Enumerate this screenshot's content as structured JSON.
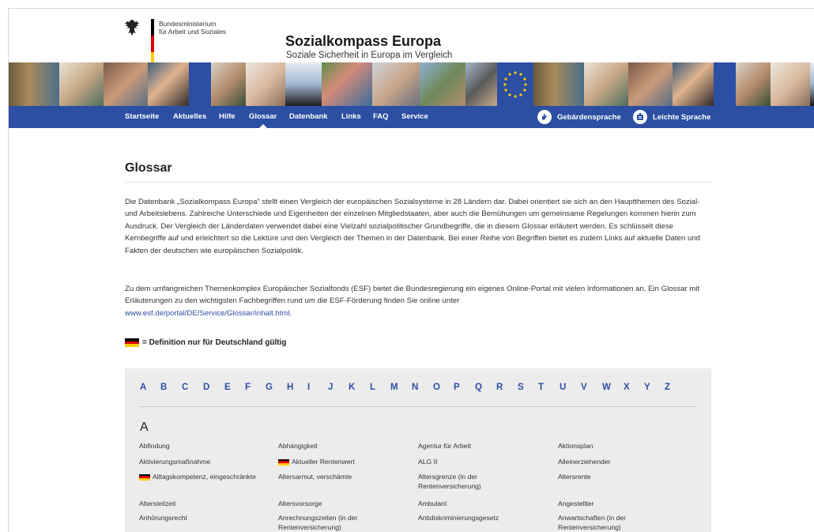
{
  "ministry": {
    "line1": "Bundesministerium",
    "line2": "für Arbeit und Soziales"
  },
  "site": {
    "title": "Sozialkompass Europa",
    "subtitle": "Soziale Sicherheit in Europa im Vergleich"
  },
  "nav": {
    "items": [
      "Startseite",
      "Aktuelles",
      "Hilfe",
      "Glossar",
      "Datenbank",
      "Links",
      "FAQ",
      "Service"
    ],
    "active": "Glossar",
    "right": [
      {
        "label": "Gebärdensprache",
        "icon": "sign-language-icon"
      },
      {
        "label": "Leichte Sprache",
        "icon": "easy-language-icon"
      }
    ]
  },
  "page": {
    "title": "Glossar",
    "paragraph1": "Die Datenbank „Sozialkompass Europa“ stellt einen Vergleich der europäischen Sozialsysteme in 28 Ländern dar. Dabei orientiert sie sich an den Hauptthemen des Sozial- und Arbeitslebens. Zahlreiche Unterschiede und Eigenheiten der einzelnen Mitgliedstaaten, aber auch die Bemühungen um gemeinsame Regelungen kommen hierin zum Ausdruck. Der Vergleich der Länderdaten verwendet dabei eine Vielzahl sozialpolitischer Grundbegriffe, die in diesem Glossar erläutert werden. Es schlüsselt diese Kernbegriffe auf und erleichtert so die Lektüre und den Vergleich der Themen in der Datenbank. Bei einer Reihe von Begriffen bietet es zudem Links auf aktuelle Daten und Fakten der deutschen wie europäischen Sozialpolitik.",
    "paragraph2": "Zu dem umfangreichen Themenkomplex Europäischer Sozialfonds (ESF) bietet die Bundesregierung ein eigenes Online-Portal mit vielen Informationen an. Ein Glossar mit Erläuterungen zu den wichtigsten Fachbegriffen rund um die ESF-Förderung finden Sie online unter",
    "link": "www.esf.de/portal/DE/Service/Glossar/inhalt.html.",
    "legend": "= Definition nur für Deutschland gültig"
  },
  "glossary": {
    "alphabet": [
      "A",
      "B",
      "C",
      "D",
      "E",
      "F",
      "G",
      "H",
      "I",
      "J",
      "K",
      "L",
      "M",
      "N",
      "O",
      "P",
      "Q",
      "R",
      "S",
      "T",
      "U",
      "V",
      "W",
      "X",
      "Y",
      "Z"
    ],
    "current_letter": "A",
    "columns": [
      [
        {
          "term": "Abfindung",
          "de": false
        },
        {
          "term": "Aktivierungsmaßnahme",
          "de": false
        },
        {
          "term": "Alltagskompetenz, eingeschränkte",
          "de": true
        },
        {
          "term": "Altersteilzeit",
          "de": false
        },
        {
          "term": "Anhörungsrecht",
          "de": false
        }
      ],
      [
        {
          "term": "Abhängigkeit",
          "de": false
        },
        {
          "term": "Aktueller Rentenwert",
          "de": true
        },
        {
          "term": "Altersarmut, verschämte",
          "de": false
        },
        {
          "term": "Altersvorsorge",
          "de": false
        },
        {
          "term": "Anrechnungszeiten (in der Rentenversicherung)",
          "de": false
        }
      ],
      [
        {
          "term": "Agentur für Arbeit",
          "de": false
        },
        {
          "term": "ALG II",
          "de": false
        },
        {
          "term": "Altersgrenze (in der Rentenversicherung)",
          "de": false
        },
        {
          "term": "Ambulant",
          "de": false
        },
        {
          "term": "Antidiskriminierungsgesetz",
          "de": false
        }
      ],
      [
        {
          "term": "Aktionsplan",
          "de": false
        },
        {
          "term": "Alleinerziehender",
          "de": false
        },
        {
          "term": "Altersrente",
          "de": false
        },
        {
          "term": "Angestellter",
          "de": false
        },
        {
          "term": "Anwartschaften (in der Rentenversicherung)",
          "de": false
        }
      ]
    ]
  },
  "colors": {
    "nav_blue": "#2c4fa3",
    "link_blue": "#2c4fa3",
    "glossary_bg": "#ececec",
    "flag_black": "#000000",
    "flag_red": "#dd0000",
    "flag_gold": "#ffce00"
  }
}
